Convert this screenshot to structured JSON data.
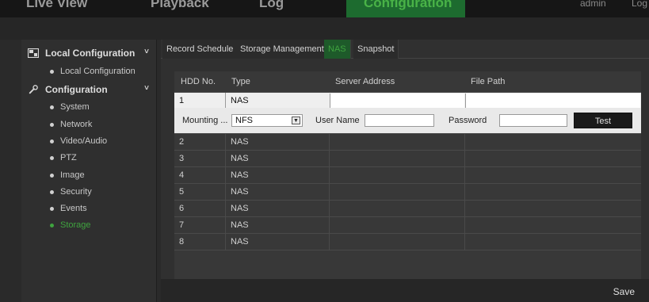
{
  "topnav": {
    "live_view": "Live View",
    "playback": "Playback",
    "log": "Log",
    "configuration": "Configuration",
    "user": "admin",
    "logout": "Log"
  },
  "sidebar": {
    "local_config": "Local Configuration",
    "local_items": [
      "Local Configuration"
    ],
    "config": "Configuration",
    "config_items": [
      "System",
      "Network",
      "Video/Audio",
      "PTZ",
      "Image",
      "Security",
      "Events",
      "Storage"
    ],
    "active_item": "Storage"
  },
  "tabs": [
    "Record Schedule",
    "Storage Management",
    "NAS",
    "Snapshot"
  ],
  "active_tab": "NAS",
  "table": {
    "headers": [
      "HDD No.",
      "Type",
      "Server Address",
      "File Path"
    ],
    "rows": [
      {
        "no": "1",
        "type": "NAS"
      },
      {
        "no": "2",
        "type": "NAS"
      },
      {
        "no": "3",
        "type": "NAS"
      },
      {
        "no": "4",
        "type": "NAS"
      },
      {
        "no": "5",
        "type": "NAS"
      },
      {
        "no": "6",
        "type": "NAS"
      },
      {
        "no": "7",
        "type": "NAS"
      },
      {
        "no": "8",
        "type": "NAS"
      }
    ]
  },
  "mounting": {
    "label": "Mounting ...",
    "protocol": "NFS",
    "username_label": "User Name",
    "password_label": "Password",
    "test_label": "Test"
  },
  "save_label": "Save",
  "colors": {
    "accent": "#3fa33f",
    "active_tab_bg": "#1e5a2a"
  }
}
